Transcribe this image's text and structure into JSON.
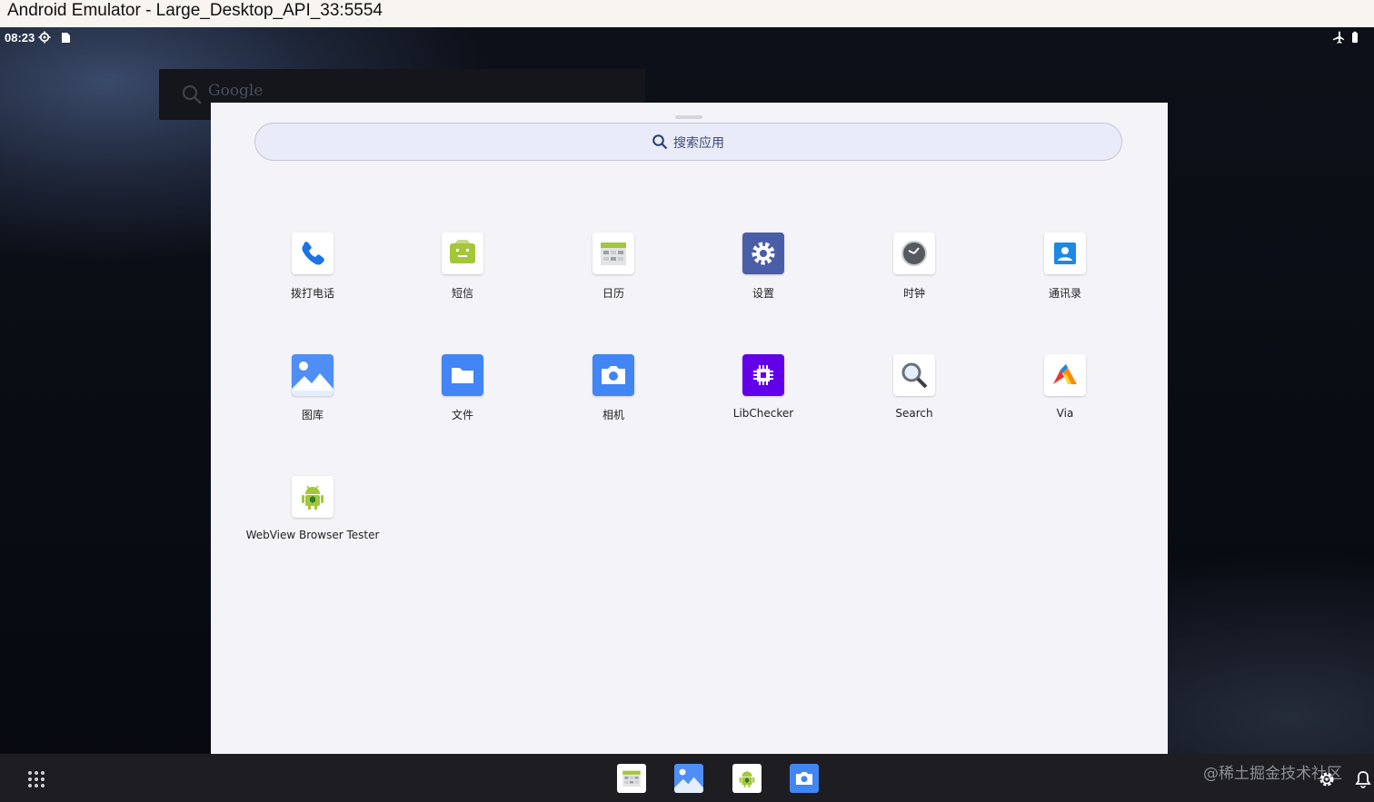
{
  "window": {
    "title": "Android Emulator - Large_Desktop_API_33:5554"
  },
  "status_bar": {
    "time": "08:23"
  },
  "google_widget": {
    "text": "Google"
  },
  "drawer": {
    "search_placeholder": "搜索应用",
    "apps": [
      {
        "label": "拨打电话",
        "icon": "phone-icon"
      },
      {
        "label": "短信",
        "icon": "messages-icon"
      },
      {
        "label": "日历",
        "icon": "calendar-icon"
      },
      {
        "label": "设置",
        "icon": "settings-icon"
      },
      {
        "label": "时钟",
        "icon": "clock-icon"
      },
      {
        "label": "通讯录",
        "icon": "contacts-icon"
      },
      {
        "label": "图库",
        "icon": "gallery-icon"
      },
      {
        "label": "文件",
        "icon": "files-icon"
      },
      {
        "label": "相机",
        "icon": "camera-icon"
      },
      {
        "label": "LibChecker",
        "icon": "libchecker-icon"
      },
      {
        "label": "Search",
        "icon": "search-app-icon"
      },
      {
        "label": "Via",
        "icon": "via-icon"
      },
      {
        "label": "WebView Browser Tester",
        "icon": "android-icon"
      }
    ]
  },
  "taskbar": {
    "pinned": [
      "calendar-icon",
      "gallery-icon",
      "android-icon",
      "camera-icon"
    ],
    "watermark": "@稀土掘金技术社区"
  },
  "colors": {
    "drawer_bg": "#f4f3f8",
    "search_bg": "#e9ecf8",
    "taskbar_bg": "#1e1e22",
    "accent_blue": "#4285f4"
  }
}
